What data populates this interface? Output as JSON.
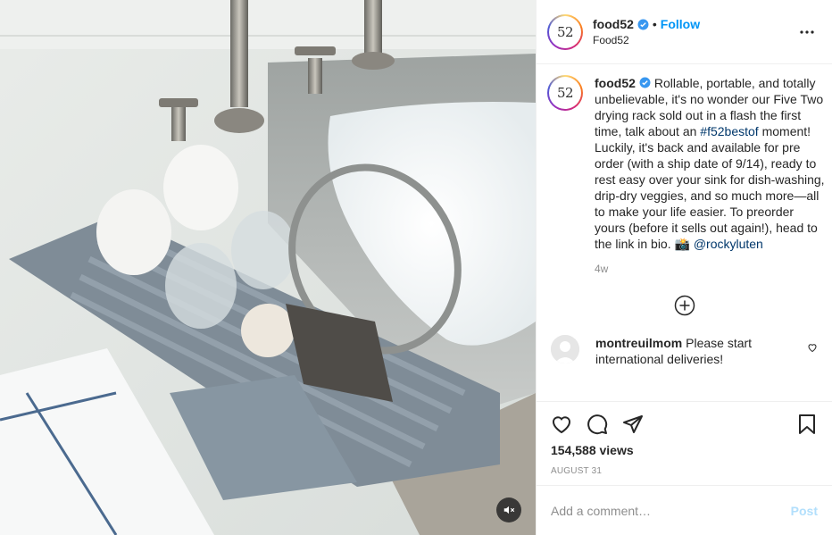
{
  "post": {
    "author": {
      "username": "food52",
      "avatar_text": "52",
      "verified": true,
      "follow_label": "Follow",
      "location": "Food52"
    },
    "more_icon": "more-horizontal-icon",
    "caption": {
      "username": "food52",
      "text_before": "Rollable, portable, and totally unbelievable, it's no wonder our Five Two drying rack sold out in a flash the first time, talk about an ",
      "hashtag": "#f52bestof",
      "text_after": " moment! Luckily, it's back and available for pre order (with a ship date of 9/14), ready to rest easy over your sink for dish-washing, drip-dry veggies, and so much more—all to make your life easier. To preorder yours (before it sells out again!), head to the link in bio. 📸 ",
      "mention": "@rockyluten",
      "age": "4w"
    },
    "load_more_icon": "plus-circle-icon",
    "comments": [
      {
        "username": "montreuilmom",
        "text": "Please start international deliveries!"
      }
    ],
    "actions": {
      "like_icon": "heart-icon",
      "comment_icon": "comment-icon",
      "share_icon": "paper-plane-icon",
      "save_icon": "bookmark-icon"
    },
    "views": "154,588 views",
    "date": "AUGUST 31",
    "add_comment": {
      "placeholder": "Add a comment…",
      "post_label": "Post"
    },
    "media": {
      "type": "video",
      "mute_icon": "muted-speaker-icon"
    },
    "colors": {
      "accent": "#0095f6",
      "link": "#00376b",
      "secondary_text": "#8e8e8e",
      "post_disabled": "#b2dffc"
    }
  }
}
